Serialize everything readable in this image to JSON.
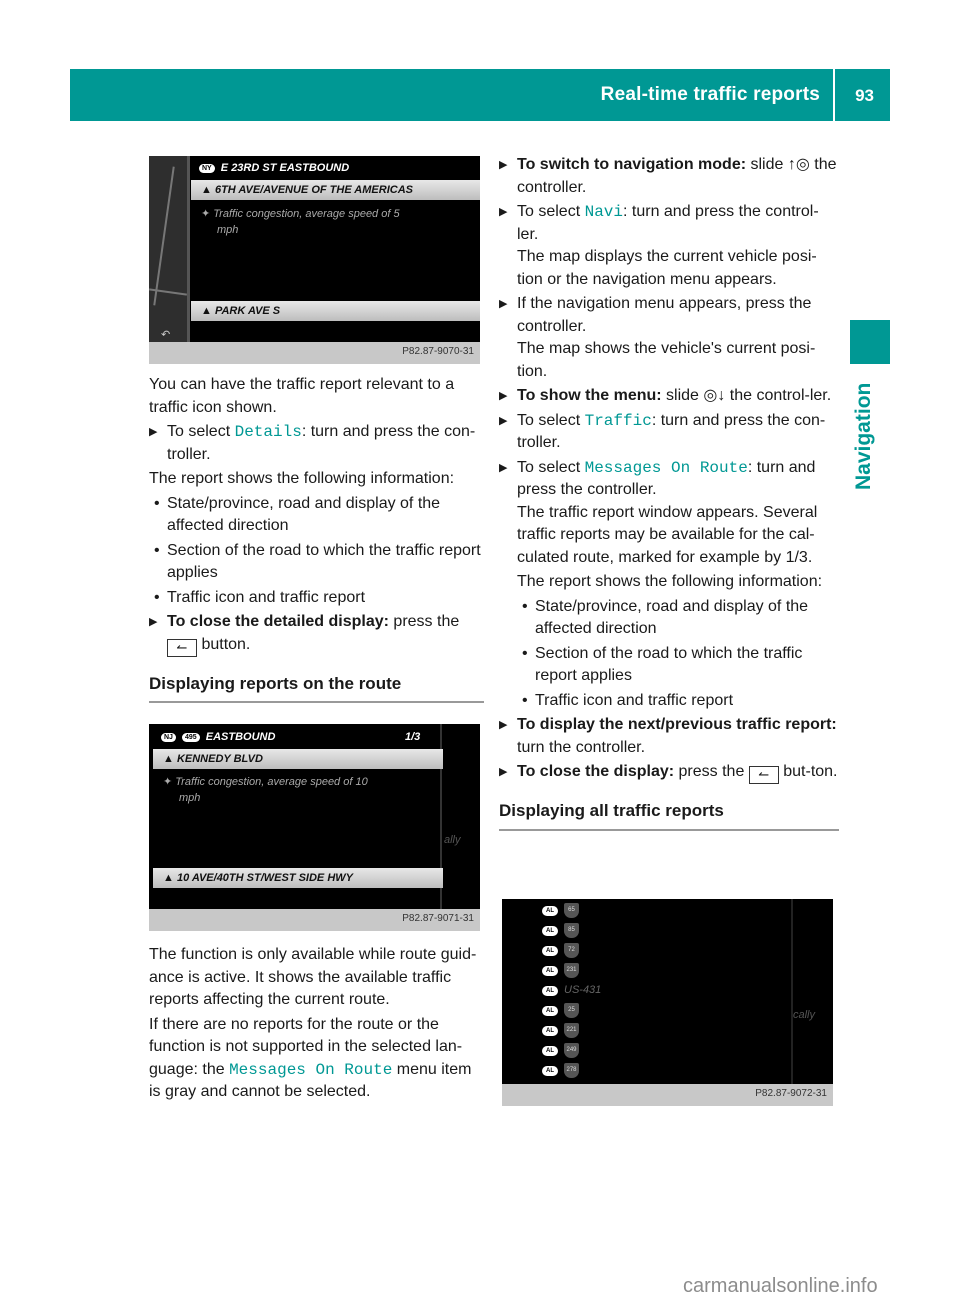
{
  "header": {
    "title": "Real-time traffic reports",
    "page_number": "93",
    "accent_color": "#009894"
  },
  "side_tab": {
    "label": "Navigation"
  },
  "screenshot1": {
    "direction_badge": "NY",
    "direction": "E 23RD ST EASTBOUND",
    "from_road": "6TH AVE/AVENUE OF THE AMERICAS",
    "report_line1": "Traffic congestion, average speed of 5",
    "report_line2": "mph",
    "to_road": "PARK AVE S",
    "back_icon": "back-icon",
    "caption": "P82.87-9070-31"
  },
  "left": {
    "intro": "You can have the traffic report relevant to a traffic icon shown.",
    "step1_prefix": "To select ",
    "step1_code": "Details",
    "step1_suffix": ": turn and press the con-troller.",
    "report_intro": "The report shows the following information:",
    "bullets": [
      "State/province, road and display of the affected direction",
      "Section of the road to which the traffic report applies",
      "Traffic icon and traffic report"
    ],
    "close_bold": "To close the detailed display:",
    "close_text": " press the",
    "close_button_suffix": " button.",
    "section_heading": "Displaying reports on the route",
    "para1": "The function is only available while route guid-ance is active. It shows the available traffic reports affecting the current route.",
    "para2_prefix": "If there are no reports for the route or the function is not supported in the selected lan-guage: the ",
    "para2_code": "Messages On Route",
    "para2_suffix": " menu item is gray and cannot be selected."
  },
  "screenshot2": {
    "badge1": "NJ",
    "badge2": "495",
    "direction": "EASTBOUND",
    "counter": "1/3",
    "from_road": "KENNEDY BLVD",
    "report_line1": "Traffic congestion, average speed of 10",
    "report_line2": "mph",
    "to_road": "10 AVE/40TH ST/WEST SIDE HWY",
    "side_fragment": "ally",
    "caption": "P82.87-9071-31"
  },
  "right": {
    "s1_bold": "To switch to navigation mode:",
    "s1_text": " slide ↑◎ the controller.",
    "s2_prefix": "To select ",
    "s2_code": "Navi",
    "s2_suffix": ": turn and press the control-ler.",
    "s2_result": "The map displays the current vehicle posi-tion or the navigation menu appears.",
    "s3_text": "If the navigation menu appears, press the controller.",
    "s3_result": "The map shows the vehicle's current posi-tion.",
    "s4_bold": "To show the menu:",
    "s4_text": " slide ◎↓ the control-ler.",
    "s5_prefix": "To select ",
    "s5_code": "Traffic",
    "s5_suffix": ": turn and press the con-troller.",
    "s6_prefix": "To select ",
    "s6_code": "Messages On Route",
    "s6_suffix": ": turn and press the controller.",
    "s6_result": "The traffic report window appears. Several traffic reports may be available for the cal-culated route, marked for example by 1/3.",
    "report_intro": "The report shows the following information:",
    "bullets": [
      "State/province, road and display of the affected direction",
      "Section of the road to which the traffic report applies",
      "Traffic icon and traffic report"
    ],
    "s7_bold": "To display the next/previous traffic report:",
    "s7_text": " turn the controller.",
    "s8_bold": "To close the display:",
    "s8_text": " press the",
    "s8_suffix": " but-ton.",
    "section_heading": "Displaying all traffic reports"
  },
  "screenshot3": {
    "state": "AL",
    "roads": [
      "65",
      "85",
      "72",
      "231",
      "US-431",
      "25",
      "221",
      "249",
      "278"
    ],
    "side_fragment": "cally",
    "caption": "P82.87-9072-31"
  },
  "watermark": "carmanualsonline.info"
}
